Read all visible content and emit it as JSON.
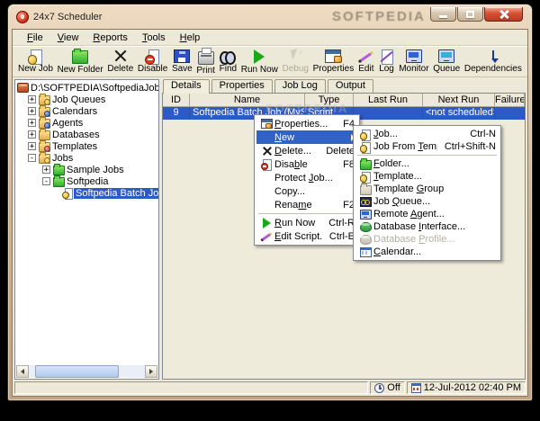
{
  "window": {
    "title": "24x7 Scheduler",
    "app_icon": "alarm-clock",
    "controls": {
      "minimize": "minimize",
      "maximize": "maximize",
      "close": "close"
    }
  },
  "watermarks": {
    "titlebar": "SOFTPEDIA",
    "content": "SOFTPEDIA"
  },
  "menubar": {
    "items": [
      {
        "label": "File"
      },
      {
        "label": "View"
      },
      {
        "label": "Reports"
      },
      {
        "label": "Tools"
      },
      {
        "label": "Help"
      }
    ]
  },
  "toolbar": {
    "buttons": [
      {
        "label": "New Job",
        "icon": "new-job",
        "disabled": false
      },
      {
        "label": "New Folder",
        "icon": "new-folder",
        "disabled": false
      },
      {
        "label": "Delete",
        "icon": "delete",
        "disabled": false
      },
      {
        "label": "Disable",
        "icon": "disable",
        "disabled": false
      },
      {
        "label": "Save",
        "icon": "save",
        "disabled": false
      },
      {
        "label": "Print",
        "icon": "print",
        "disabled": false
      },
      {
        "label": "Find",
        "icon": "find",
        "disabled": false
      },
      {
        "label": "Run Now",
        "icon": "run",
        "disabled": false
      },
      {
        "label": "Debug",
        "icon": "debug",
        "disabled": true
      },
      {
        "label": "Properties",
        "icon": "properties",
        "disabled": false
      },
      {
        "label": "Edit",
        "icon": "edit",
        "disabled": false
      },
      {
        "label": "Log",
        "icon": "log",
        "disabled": false
      },
      {
        "label": "Monitor",
        "icon": "monitor",
        "disabled": false
      },
      {
        "label": "Queue",
        "icon": "queue",
        "disabled": false
      },
      {
        "label": "Dependencies",
        "icon": "dependencies",
        "disabled": false
      }
    ]
  },
  "tree": {
    "root": {
      "label": "D:\\SOFTPEDIA\\SoftpediaJobDB.dat",
      "icon": "db-file"
    },
    "items": [
      {
        "label": "Job Queues",
        "icon": "folder-queues",
        "expanded": false
      },
      {
        "label": "Calendars",
        "icon": "folder-calendars",
        "expanded": false
      },
      {
        "label": "Agents",
        "icon": "folder-agents",
        "expanded": false
      },
      {
        "label": "Databases",
        "icon": "folder-databases",
        "expanded": false
      },
      {
        "label": "Templates",
        "icon": "folder-templates",
        "expanded": false
      },
      {
        "label": "Jobs",
        "icon": "folder-jobs",
        "expanded": true,
        "children": [
          {
            "label": "Sample Jobs",
            "icon": "folder-green",
            "expanded": false
          },
          {
            "label": "Softpedia",
            "icon": "folder-green-open",
            "expanded": true,
            "children": [
              {
                "label": "Softpedia Batch Job (MySQL S...",
                "icon": "job",
                "selected": true
              }
            ]
          }
        ]
      }
    ]
  },
  "tabs": [
    {
      "label": "Details",
      "active": true
    },
    {
      "label": "Properties",
      "active": false
    },
    {
      "label": "Job Log",
      "active": false
    },
    {
      "label": "Output",
      "active": false
    }
  ],
  "table": {
    "columns": [
      "ID",
      "Name",
      "Type",
      "Last Run",
      "Next Run",
      "Failures"
    ],
    "rows": [
      {
        "id": "9",
        "name": "Softpedia Batch Job (MySQL S...",
        "type": "Script",
        "last_run": "",
        "next_run": "<not scheduled>",
        "failures": "",
        "selected": true
      }
    ]
  },
  "context_menu": {
    "items": [
      {
        "label": "Properties...",
        "shortcut": "F4",
        "icon": "properties"
      },
      {
        "label": "New",
        "shortcut": "",
        "icon": "",
        "highlighted": true,
        "has_submenu": true
      },
      {
        "label": "Delete...",
        "shortcut": "Delete",
        "icon": "delete"
      },
      {
        "label": "Disable",
        "shortcut": "F8",
        "icon": "disable"
      },
      {
        "label": "Protect Job...",
        "shortcut": "",
        "icon": ""
      },
      {
        "label": "Copy...",
        "shortcut": "",
        "icon": ""
      },
      {
        "label": "Rename",
        "shortcut": "F2",
        "icon": ""
      },
      {
        "separator": true
      },
      {
        "label": "Run Now",
        "shortcut": "Ctrl-R",
        "icon": "run"
      },
      {
        "label": "Edit Script...",
        "shortcut": "Ctrl-E",
        "icon": "edit"
      }
    ]
  },
  "submenu": {
    "items": [
      {
        "label": "Job...",
        "shortcut": "Ctrl-N",
        "icon": "job"
      },
      {
        "label": "Job From Template...",
        "shortcut": "Ctrl+Shift-N",
        "icon": "job-template"
      },
      {
        "separator": true
      },
      {
        "label": "Folder...",
        "shortcut": "",
        "icon": "folder-green"
      },
      {
        "label": "Template...",
        "shortcut": "",
        "icon": "template"
      },
      {
        "label": "Template Group",
        "shortcut": "",
        "icon": "template-group"
      },
      {
        "label": "Job Queue...",
        "shortcut": "",
        "icon": "job-queue"
      },
      {
        "label": "Remote Agent...",
        "shortcut": "",
        "icon": "remote-agent"
      },
      {
        "label": "Database Interface...",
        "shortcut": "",
        "icon": "db-interface"
      },
      {
        "label": "Database Profile...",
        "shortcut": "",
        "icon": "db-profile",
        "disabled": true
      },
      {
        "label": "Calendar...",
        "shortcut": "",
        "icon": "calendar"
      }
    ]
  },
  "statusbar": {
    "scheduler_state": "Off",
    "state_icon": "clock-status",
    "datetime": "12-Jul-2012 02:40 PM",
    "date_icon": "cal-status"
  }
}
